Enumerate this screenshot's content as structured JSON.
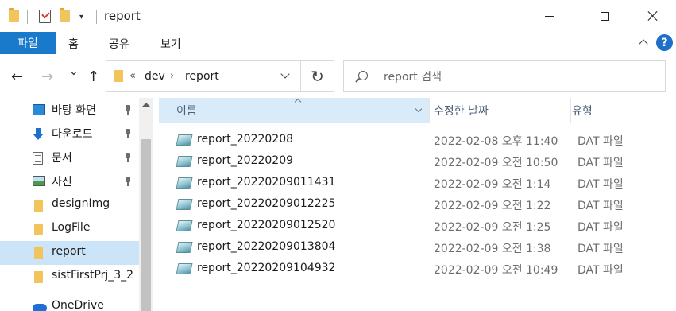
{
  "window": {
    "title": "report"
  },
  "ribbon": {
    "tabs": [
      "파일",
      "홈",
      "공유",
      "보기"
    ],
    "help": "?"
  },
  "address": {
    "overflow": "«",
    "crumbs": [
      "dev",
      "report"
    ],
    "separator": "›"
  },
  "search": {
    "placeholder": "report 검색"
  },
  "nav": {
    "back": "←",
    "forward": "→",
    "recent": "⌄",
    "up": "↑",
    "refresh": "↻"
  },
  "navpane": {
    "items": [
      {
        "label": "바탕 화면",
        "icon": "desktop-icon",
        "pinned": true
      },
      {
        "label": "다운로드",
        "icon": "download-icon",
        "pinned": true
      },
      {
        "label": "문서",
        "icon": "documents-icon",
        "pinned": true
      },
      {
        "label": "사진",
        "icon": "pictures-icon",
        "pinned": true
      },
      {
        "label": "designImg",
        "icon": "folder-icon",
        "pinned": false
      },
      {
        "label": "LogFile",
        "icon": "folder-icon",
        "pinned": false
      },
      {
        "label": "report",
        "icon": "folder-icon",
        "pinned": false,
        "selected": true
      },
      {
        "label": "sistFirstPrj_3_2",
        "icon": "folder-icon",
        "pinned": false
      },
      {
        "label": "OneDrive",
        "icon": "onedrive-icon",
        "pinned": false
      }
    ]
  },
  "columns": {
    "name": "이름",
    "date": "수정한 날짜",
    "type": "유형"
  },
  "files": [
    {
      "name": "report_20220208",
      "date": "2022-02-08 오후 11:40",
      "type": "DAT 파일"
    },
    {
      "name": "report_20220209",
      "date": "2022-02-09 오전 10:50",
      "type": "DAT 파일"
    },
    {
      "name": "report_20220209011431",
      "date": "2022-02-09 오전 1:14",
      "type": "DAT 파일"
    },
    {
      "name": "report_20220209012225",
      "date": "2022-02-09 오전 1:22",
      "type": "DAT 파일"
    },
    {
      "name": "report_20220209012520",
      "date": "2022-02-09 오전 1:25",
      "type": "DAT 파일"
    },
    {
      "name": "report_20220209013804",
      "date": "2022-02-09 오전 1:38",
      "type": "DAT 파일"
    },
    {
      "name": "report_20220209104932",
      "date": "2022-02-09 오전 10:49",
      "type": "DAT 파일"
    }
  ],
  "colors": {
    "file_tab": "#1979ca",
    "selected": "#cce4f7",
    "header_hover": "#d9ebf9"
  }
}
